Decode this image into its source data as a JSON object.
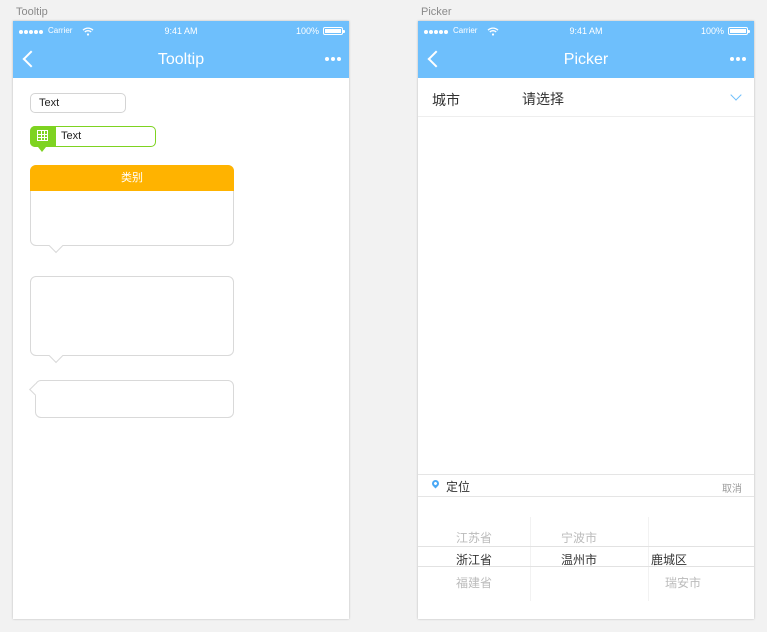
{
  "artboards": {
    "tooltip": {
      "label": "Tooltip",
      "status": {
        "carrier": "Carrier",
        "time": "9:41 AM",
        "battery": "100%"
      },
      "nav_title": "Tooltip",
      "text_tip": "Text",
      "green_tip": "Text",
      "category_header": "类别"
    },
    "picker": {
      "label": "Picker",
      "status": {
        "carrier": "Carrier",
        "time": "9:41 AM",
        "battery": "100%"
      },
      "nav_title": "Picker",
      "city_label": "城市",
      "city_value": "请选择",
      "toolbar": {
        "locate": "定位",
        "cancel": "取消"
      },
      "columns": [
        {
          "above": "江苏省",
          "selected": "浙江省",
          "below": "福建省"
        },
        {
          "above": "宁波市",
          "selected": "温州市",
          "below": ""
        },
        {
          "above": "",
          "selected": "鹿城区",
          "below": "瑞安市"
        }
      ]
    }
  },
  "colors": {
    "nav": "#6ebffc",
    "green": "#7ed321",
    "orange": "#ffb300",
    "pin": "#4aa8f5"
  }
}
